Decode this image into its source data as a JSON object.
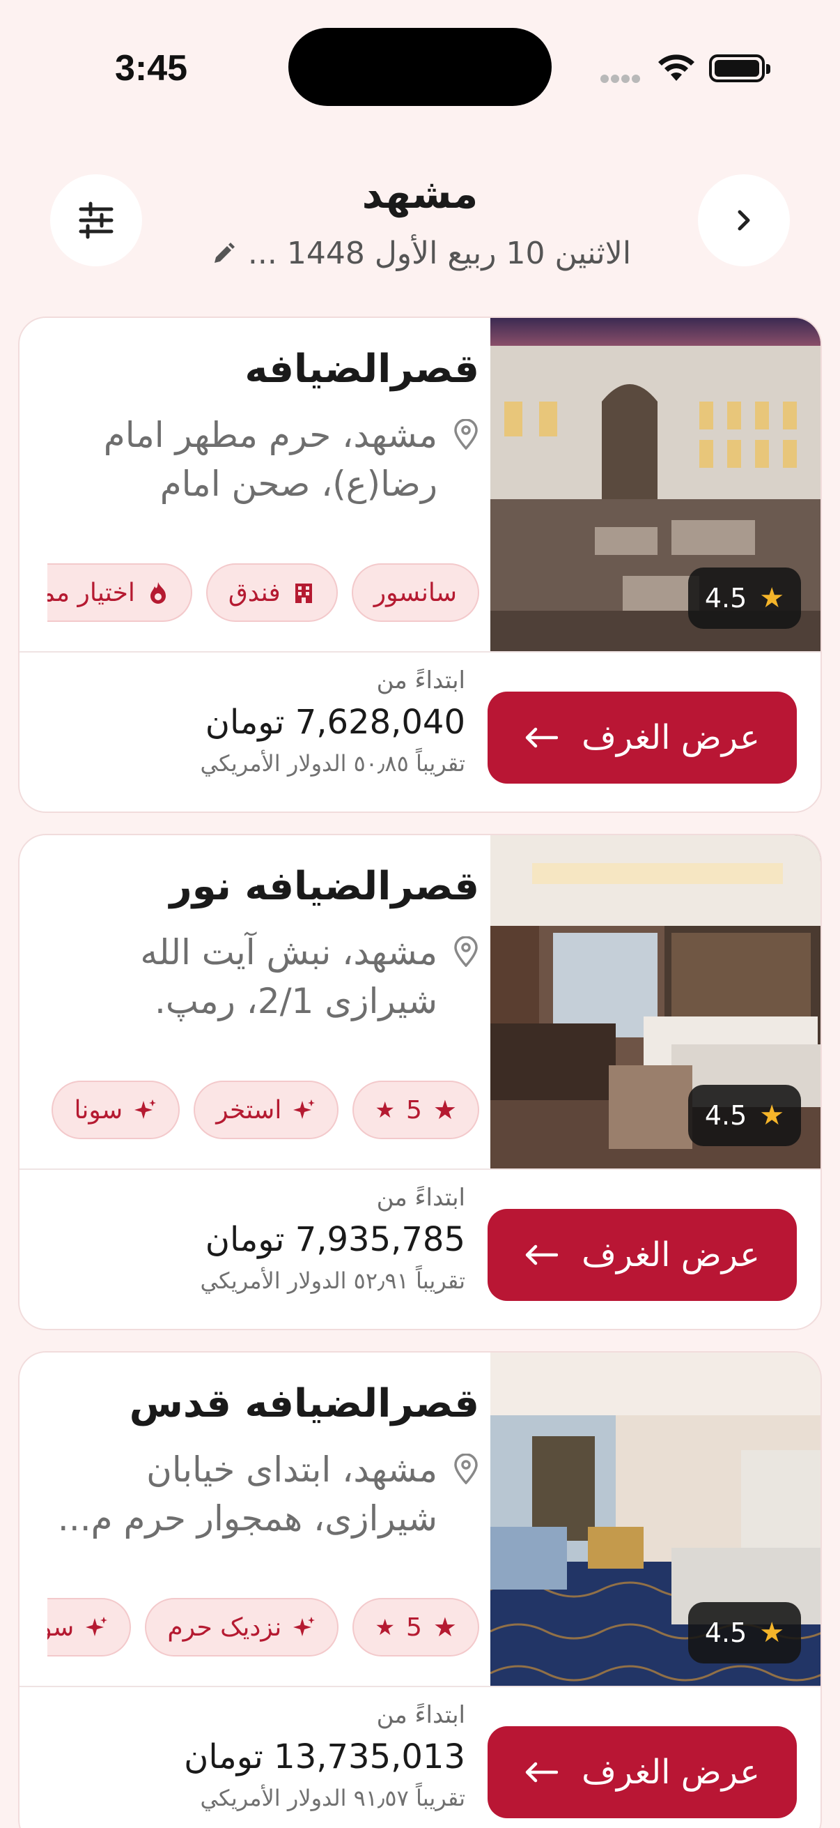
{
  "status_bar": {
    "time": "3:45"
  },
  "header": {
    "title": "مشهد",
    "subtitle": "الاثنين 10 ربيع الأول 1448 ..."
  },
  "hotels": [
    {
      "name": "قصرالضيافه",
      "address": "مشهد، حرم مطهر امام رضا(ع)، صحن امام حسن...",
      "rating": "4.5",
      "tags": [
        {
          "icon": "fire-icon",
          "label": "اختيار مميز"
        },
        {
          "icon": "building-icon",
          "label": "فندق"
        },
        {
          "icon": "none",
          "label": "سانسور"
        }
      ],
      "price_from": "ابتداءً من",
      "price": "7,628,040 تومان",
      "usd": "تقريباً ٥٠٫٨٥ الدولار الأمريكي",
      "cta": "عرض الغرف"
    },
    {
      "name": "قصرالضيافه نور",
      "address": "مشهد، نبش آيت الله شيرازى 2/1، رمپ.",
      "rating": "4.5",
      "tags": [
        {
          "icon": "star-icon",
          "label": "5"
        },
        {
          "icon": "sparkle-icon",
          "label": "استخر"
        },
        {
          "icon": "sparkle-icon",
          "label": "سونا"
        }
      ],
      "price_from": "ابتداءً من",
      "price": "7,935,785 تومان",
      "usd": "تقريباً ٥٢٫٩١ الدولار الأمريكي",
      "cta": "عرض الغرف"
    },
    {
      "name": "قصرالضيافه قدس",
      "address": "مشهد، ابتداى خيابان شيرازى، همجوار حرم م...",
      "rating": "4.5",
      "tags": [
        {
          "icon": "star-icon",
          "label": "5"
        },
        {
          "icon": "sparkle-icon",
          "label": "نزديک حرم"
        },
        {
          "icon": "sparkle-icon",
          "label": "سونا"
        }
      ],
      "price_from": "ابتداءً من",
      "price": "13,735,013 تومان",
      "usd": "تقريباً ٩١٫٥٧ الدولار الأمريكي",
      "cta": "عرض الغرف"
    }
  ],
  "colors": {
    "accent": "#b91634",
    "background": "#fdf2f1",
    "star": "#f5b52a"
  }
}
